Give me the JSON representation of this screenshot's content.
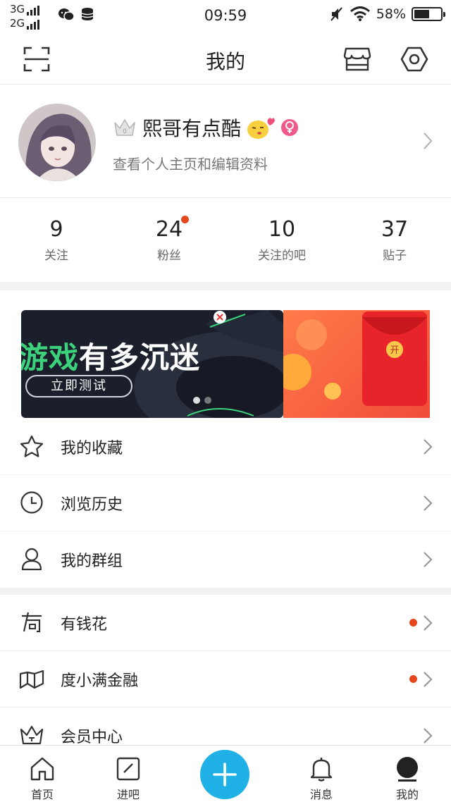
{
  "status_bar": {
    "network1": "3G",
    "network2": "2G",
    "time": "09:59",
    "battery": "58%",
    "battery_level": 0.58,
    "icons": [
      "wechat-icon",
      "database-icon",
      "mute-icon",
      "wifi-icon",
      "battery-icon"
    ]
  },
  "header": {
    "title": "我的",
    "left_icon": "scan-icon",
    "right_icons": [
      "store-icon",
      "settings-icon"
    ]
  },
  "profile": {
    "username": "熙哥有点酷",
    "subtitle": "查看个人主页和编辑资料",
    "badges": [
      "crown-icon",
      "kiss-emoji-icon",
      "female-icon"
    ]
  },
  "stats": [
    {
      "value": "9",
      "label": "关注"
    },
    {
      "value": "24",
      "label": "粉丝",
      "has_dot": true
    },
    {
      "value": "10",
      "label": "关注的吧"
    },
    {
      "value": "37",
      "label": "贴子"
    }
  ],
  "banner": {
    "headline_green": "游戏",
    "headline_white": "有多沉迷",
    "button": "立即测试",
    "second_slide_badge": "开",
    "slides": 2,
    "active_slide": 1
  },
  "menu_group1": [
    {
      "label": "我的收藏",
      "icon": "star-icon"
    },
    {
      "label": "浏览历史",
      "icon": "clock-icon"
    },
    {
      "label": "我的群组",
      "icon": "user-icon"
    }
  ],
  "menu_group2": [
    {
      "label": "有钱花",
      "icon": "youqianhua-icon",
      "has_dot": true
    },
    {
      "label": "度小满金融",
      "icon": "duxiaoman-icon",
      "has_dot": true
    },
    {
      "label": "会员中心",
      "icon": "member-crown-icon",
      "has_dot": false
    }
  ],
  "tabbar": [
    {
      "label": "首页",
      "icon": "home-icon"
    },
    {
      "label": "进吧",
      "icon": "enter-bar-icon"
    },
    {
      "label": "",
      "icon": "plus-icon"
    },
    {
      "label": "消息",
      "icon": "bell-icon"
    },
    {
      "label": "我的",
      "icon": "profile-icon"
    }
  ],
  "colors": {
    "accent_blue": "#1fb1e6",
    "notify_red": "#e5461c",
    "banner_green": "#3cd27c",
    "separator": "#f2f2f4"
  }
}
